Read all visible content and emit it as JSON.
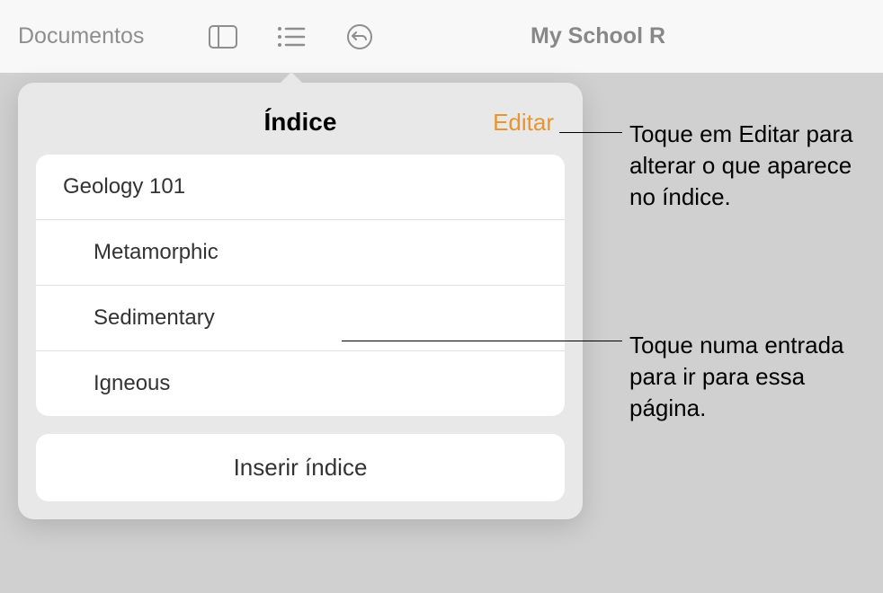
{
  "toolbar": {
    "documents_label": "Documentos",
    "doc_title": "My School R"
  },
  "popover": {
    "title": "Índice",
    "edit_label": "Editar",
    "toc_items": [
      {
        "label": "Geology 101",
        "indent": false
      },
      {
        "label": "Metamorphic",
        "indent": true
      },
      {
        "label": "Sedimentary",
        "indent": true
      },
      {
        "label": "Igneous",
        "indent": true
      }
    ],
    "insert_label": "Inserir índice"
  },
  "callouts": {
    "edit_callout": "Toque em Editar para alterar o que aparece no índice.",
    "entry_callout": "Toque numa entrada para ir para essa página."
  }
}
